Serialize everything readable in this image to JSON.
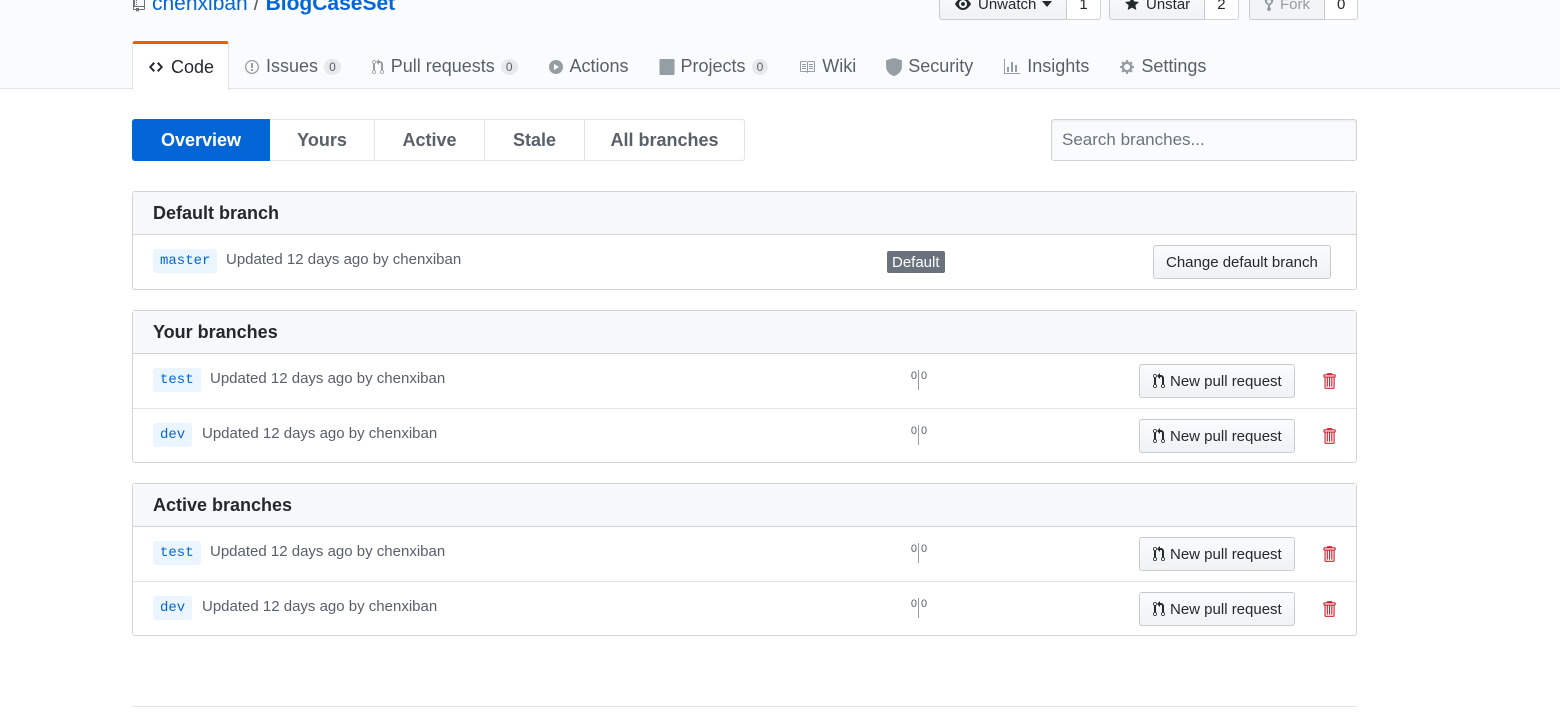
{
  "repo": {
    "owner": "chenxiban",
    "separator": "/",
    "name": "BlogCaseSet"
  },
  "actions": {
    "watch": {
      "label": "Unwatch",
      "count": "1"
    },
    "star": {
      "label": "Unstar",
      "count": "2"
    },
    "fork": {
      "label": "Fork",
      "count": "0"
    }
  },
  "nav": {
    "code": "Code",
    "issues": {
      "label": "Issues",
      "count": "0"
    },
    "pulls": {
      "label": "Pull requests",
      "count": "0"
    },
    "actions": "Actions",
    "projects": {
      "label": "Projects",
      "count": "0"
    },
    "wiki": "Wiki",
    "security": "Security",
    "insights": "Insights",
    "settings": "Settings"
  },
  "subnav": {
    "overview": "Overview",
    "yours": "Yours",
    "active": "Active",
    "stale": "Stale",
    "all": "All branches"
  },
  "search": {
    "placeholder": "Search branches..."
  },
  "default_section": {
    "title": "Default branch",
    "branch": "master",
    "meta": "Updated 12 days ago by chenxiban",
    "label": "Default",
    "button": "Change default branch"
  },
  "your_section": {
    "title": "Your branches",
    "rows": [
      {
        "branch": "test",
        "meta": "Updated 12 days ago by chenxiban",
        "behind": "0",
        "ahead": "0",
        "button": "New pull request"
      },
      {
        "branch": "dev",
        "meta": "Updated 12 days ago by chenxiban",
        "behind": "0",
        "ahead": "0",
        "button": "New pull request"
      }
    ]
  },
  "active_section": {
    "title": "Active branches",
    "rows": [
      {
        "branch": "test",
        "meta": "Updated 12 days ago by chenxiban",
        "behind": "0",
        "ahead": "0",
        "button": "New pull request"
      },
      {
        "branch": "dev",
        "meta": "Updated 12 days ago by chenxiban",
        "behind": "0",
        "ahead": "0",
        "button": "New pull request"
      }
    ]
  },
  "colors": {
    "accent": "#0366d6",
    "tab_highlight": "#e36209",
    "danger": "#cb2431"
  }
}
